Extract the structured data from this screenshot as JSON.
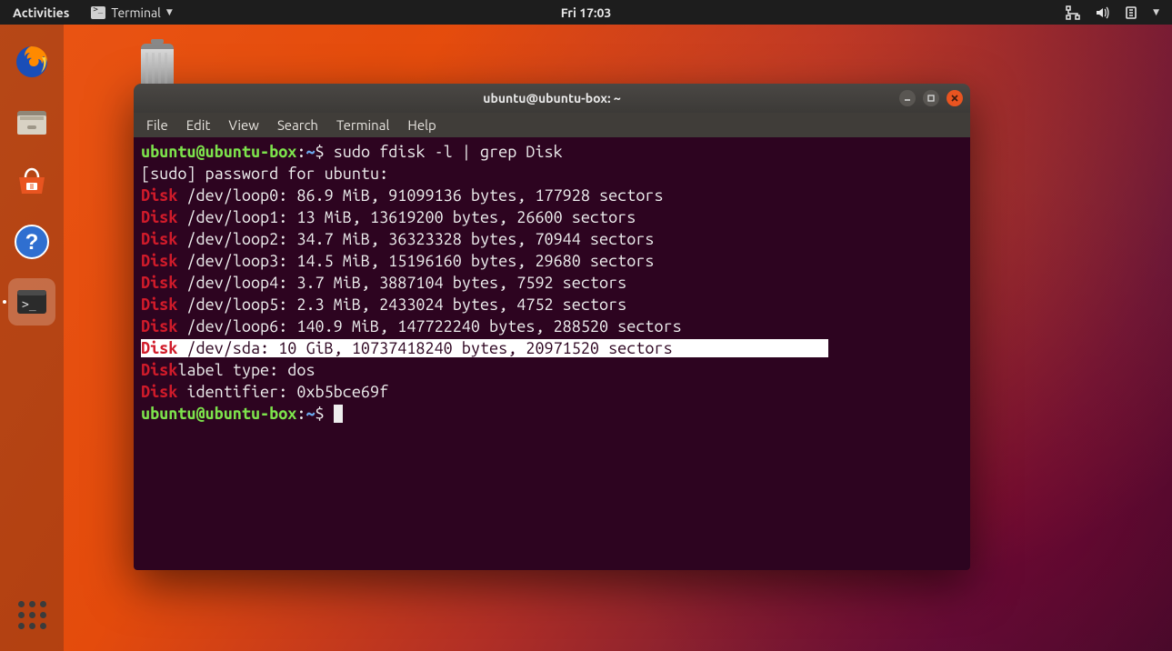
{
  "panel": {
    "activities": "Activities",
    "app_label": "Terminal",
    "clock": "Fri 17:03"
  },
  "dock": {
    "items": [
      {
        "name": "firefox"
      },
      {
        "name": "files"
      },
      {
        "name": "software"
      },
      {
        "name": "help"
      },
      {
        "name": "terminal"
      }
    ]
  },
  "window": {
    "title": "ubuntu@ubuntu-box: ~",
    "menu": [
      "File",
      "Edit",
      "View",
      "Search",
      "Terminal",
      "Help"
    ]
  },
  "term": {
    "prompt_user": "ubuntu@ubuntu-box",
    "prompt_sep": ":",
    "prompt_path": "~",
    "prompt_tail": "$ ",
    "command": "sudo fdisk -l | grep Disk",
    "sudo_prompt": "[sudo] password for ubuntu:",
    "lines": [
      {
        "kw": "Disk",
        "rest": " /dev/loop0: 86.9 MiB, 91099136 bytes, 177928 sectors"
      },
      {
        "kw": "Disk",
        "rest": " /dev/loop1: 13 MiB, 13619200 bytes, 26600 sectors"
      },
      {
        "kw": "Disk",
        "rest": " /dev/loop2: 34.7 MiB, 36323328 bytes, 70944 sectors"
      },
      {
        "kw": "Disk",
        "rest": " /dev/loop3: 14.5 MiB, 15196160 bytes, 29680 sectors"
      },
      {
        "kw": "Disk",
        "rest": " /dev/loop4: 3.7 MiB, 3887104 bytes, 7592 sectors"
      },
      {
        "kw": "Disk",
        "rest": " /dev/loop5: 2.3 MiB, 2433024 bytes, 4752 sectors"
      },
      {
        "kw": "Disk",
        "rest": " /dev/loop6: 140.9 MiB, 147722240 bytes, 288520 sectors"
      },
      {
        "kw": "Disk",
        "rest": " /dev/sda: 10 GiB, 10737418240 bytes, 20971520 sectors",
        "highlight": true
      },
      {
        "kw": "Disk",
        "rest": "label type: dos"
      },
      {
        "kw": "Disk",
        "rest": " identifier: 0xb5bce69f"
      }
    ]
  }
}
